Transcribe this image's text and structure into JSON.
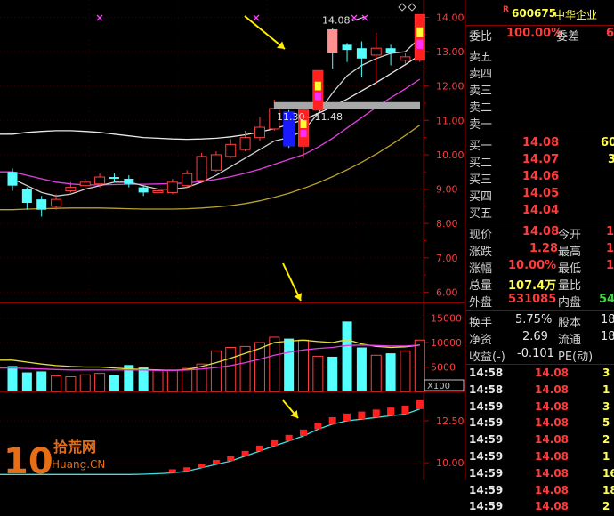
{
  "price_axis": [
    "14.00",
    "13.00",
    "12.00",
    "11.00",
    "10.00",
    "9.00",
    "8.00",
    "7.00",
    "6.00"
  ],
  "volume_axis": [
    "15000",
    "10000",
    "5000"
  ],
  "volume_unit": "X100",
  "indicator_axis": [
    "12.50",
    "10.00"
  ],
  "chart_annotations": {
    "high_label": "14.08",
    "range_label": "11.30 - 11.48"
  },
  "watermark": {
    "number": "10",
    "site": "拾荒网",
    "domain": "Huang.CN"
  },
  "quote": {
    "marker": "R",
    "code": "600675",
    "name": "中华企业",
    "webi_label": "委比",
    "webi_value": "100.00%",
    "weicha_label": "委差",
    "weicha_value": "6",
    "sell_labels": [
      "卖五",
      "卖四",
      "卖三",
      "卖二",
      "卖一"
    ],
    "buy": [
      {
        "label": "买一",
        "price": "14.08",
        "vol": "60"
      },
      {
        "label": "买二",
        "price": "14.07",
        "vol": "3"
      },
      {
        "label": "买三",
        "price": "14.06",
        "vol": ""
      },
      {
        "label": "买四",
        "price": "14.05",
        "vol": ""
      },
      {
        "label": "买五",
        "price": "14.04",
        "vol": ""
      }
    ],
    "stats": [
      {
        "l1": "现价",
        "v1": "14.08",
        "c1": "red",
        "l2": "今开",
        "v2": "1"
      },
      {
        "l1": "涨跌",
        "v1": "1.28",
        "c1": "red",
        "l2": "最高",
        "v2": "1"
      },
      {
        "l1": "涨幅",
        "v1": "10.00%",
        "c1": "red",
        "l2": "最低",
        "v2": "1"
      },
      {
        "l1": "总量",
        "v1": "107.4万",
        "c1": "yel",
        "l2": "量比",
        "v2": ""
      },
      {
        "l1": "外盘",
        "v1": "531085",
        "c1": "red",
        "l2": "内盘",
        "v2": "54"
      }
    ],
    "extra": [
      {
        "l1": "换手",
        "v1": "5.75%",
        "l2": "股本",
        "v2": "18"
      },
      {
        "l1": "净资",
        "v1": "2.69",
        "l2": "流通",
        "v2": "18"
      }
    ],
    "eps_label": "收益(-)",
    "eps_value": "-0.101",
    "pe_label": "PE(动)",
    "ticks": [
      {
        "time": "14:58",
        "price": "14.08",
        "vol": "3"
      },
      {
        "time": "14:58",
        "price": "14.08",
        "vol": "1"
      },
      {
        "time": "14:59",
        "price": "14.08",
        "vol": "3"
      },
      {
        "time": "14:59",
        "price": "14.08",
        "vol": "5"
      },
      {
        "time": "14:59",
        "price": "14.08",
        "vol": "2"
      },
      {
        "time": "14:59",
        "price": "14.08",
        "vol": "1"
      },
      {
        "time": "14:59",
        "price": "14.08",
        "vol": "16"
      },
      {
        "time": "14:59",
        "price": "14.08",
        "vol": "18"
      },
      {
        "time": "14:59",
        "price": "14.08",
        "vol": "2"
      }
    ]
  },
  "chart_data": {
    "type": "candlestick",
    "ylim": [
      5.7,
      14.4
    ],
    "volume_ylim": [
      0,
      18000
    ],
    "candles": [
      {
        "o": 9.5,
        "c": 9.1,
        "h": 9.6,
        "l": 8.95,
        "v": 5200
      },
      {
        "o": 9.0,
        "c": 8.6,
        "h": 9.05,
        "l": 8.4,
        "v": 3900
      },
      {
        "o": 8.7,
        "c": 8.4,
        "h": 8.8,
        "l": 8.2,
        "v": 4100
      },
      {
        "o": 8.5,
        "c": 8.7,
        "h": 8.85,
        "l": 8.4,
        "v": 3200
      },
      {
        "o": 8.95,
        "c": 9.05,
        "h": 9.2,
        "l": 8.9,
        "v": 3000
      },
      {
        "o": 9.1,
        "c": 9.2,
        "h": 9.3,
        "l": 9.05,
        "v": 3400
      },
      {
        "o": 9.15,
        "c": 9.35,
        "h": 9.45,
        "l": 9.05,
        "v": 3700
      },
      {
        "o": 9.35,
        "c": 9.3,
        "h": 9.45,
        "l": 9.2,
        "v": 3300
      },
      {
        "o": 9.3,
        "c": 9.15,
        "h": 9.4,
        "l": 9.05,
        "v": 5400
      },
      {
        "o": 9.05,
        "c": 8.9,
        "h": 9.1,
        "l": 8.8,
        "v": 4900
      },
      {
        "o": 8.9,
        "c": 8.95,
        "h": 9.05,
        "l": 8.8,
        "v": 4300
      },
      {
        "o": 8.9,
        "c": 9.2,
        "h": 9.3,
        "l": 8.85,
        "v": 4400
      },
      {
        "o": 9.1,
        "c": 9.45,
        "h": 9.55,
        "l": 9.05,
        "v": 4700
      },
      {
        "o": 9.25,
        "c": 9.95,
        "h": 10.05,
        "l": 9.2,
        "v": 5600
      },
      {
        "o": 9.55,
        "c": 10.0,
        "h": 10.1,
        "l": 9.5,
        "v": 8300
      },
      {
        "o": 9.95,
        "c": 10.3,
        "h": 10.45,
        "l": 9.9,
        "v": 9000
      },
      {
        "o": 10.15,
        "c": 10.5,
        "h": 10.7,
        "l": 10.1,
        "v": 9200
      },
      {
        "o": 10.5,
        "c": 10.8,
        "h": 11.1,
        "l": 10.4,
        "v": 10000
      },
      {
        "o": 10.75,
        "c": 11.35,
        "h": 11.6,
        "l": 10.7,
        "v": 11100
      },
      {
        "o": 11.25,
        "c": 10.25,
        "h": 11.3,
        "l": 10.2,
        "v": 10800
      },
      {
        "o": 10.25,
        "c": 11.3,
        "h": 11.4,
        "l": 9.9,
        "v": 10500
      },
      {
        "o": 11.3,
        "c": 12.45,
        "h": 12.45,
        "l": 11.3,
        "v": 7200
      },
      {
        "o": 13.65,
        "c": 12.95,
        "h": 13.7,
        "l": 12.5,
        "v": 7100
      },
      {
        "o": 13.2,
        "c": 13.05,
        "h": 13.25,
        "l": 12.7,
        "v": 14300
      },
      {
        "o": 13.1,
        "c": 12.8,
        "h": 13.3,
        "l": 12.25,
        "v": 9000
      },
      {
        "o": 12.9,
        "c": 13.1,
        "h": 13.55,
        "l": 12.1,
        "v": 7400
      },
      {
        "o": 13.1,
        "c": 12.95,
        "h": 13.2,
        "l": 12.6,
        "v": 7800
      },
      {
        "o": 12.75,
        "c": 12.85,
        "h": 12.95,
        "l": 12.65,
        "v": 8300
      },
      {
        "o": 12.75,
        "c": 14.08,
        "h": 14.08,
        "l": 12.7,
        "v": 10500
      }
    ],
    "ma_short": [
      9.3,
      9.1,
      8.9,
      8.8,
      8.85,
      9.0,
      9.1,
      9.2,
      9.2,
      9.1,
      9.0,
      9.0,
      9.05,
      9.2,
      9.4,
      9.65,
      9.9,
      10.15,
      10.4,
      10.5,
      10.7,
      11.2,
      11.8,
      12.3,
      12.6,
      12.8,
      12.95,
      13.0,
      13.4
    ],
    "ma_mid": [
      9.5,
      9.4,
      9.3,
      9.2,
      9.15,
      9.12,
      9.12,
      9.13,
      9.14,
      9.14,
      9.15,
      9.16,
      9.18,
      9.22,
      9.28,
      9.36,
      9.46,
      9.58,
      9.72,
      9.86,
      10.0,
      10.22,
      10.48,
      10.78,
      11.08,
      11.38,
      11.66,
      11.92,
      12.2
    ],
    "ma_long": [
      10.6,
      10.65,
      10.68,
      10.7,
      10.7,
      10.68,
      10.65,
      10.6,
      10.55,
      10.5,
      10.48,
      10.46,
      10.45,
      10.46,
      10.48,
      10.52,
      10.58,
      10.66,
      10.76,
      10.88,
      11.02,
      11.2,
      11.4,
      11.62,
      11.86,
      12.1,
      12.36,
      12.62,
      12.9
    ],
    "ma_xlong": [
      8.4,
      8.42,
      8.43,
      8.44,
      8.45,
      8.45,
      8.45,
      8.44,
      8.43,
      8.42,
      8.42,
      8.42,
      8.43,
      8.45,
      8.48,
      8.52,
      8.58,
      8.66,
      8.76,
      8.88,
      9.02,
      9.18,
      9.36,
      9.56,
      9.78,
      10.02,
      10.28,
      10.56,
      10.86
    ],
    "vol_ma_a": [
      6400,
      6000,
      5600,
      5300,
      5100,
      5000,
      5000,
      4800,
      4600,
      4500,
      4400,
      4300,
      4500,
      5100,
      5900,
      6800,
      7800,
      8800,
      10000,
      10300,
      10500,
      10200,
      10000,
      10600,
      9700,
      9200,
      9000,
      9100,
      9500
    ],
    "vol_ma_b": [
      4800,
      4700,
      4600,
      4500,
      4400,
      4400,
      4400,
      4400,
      4400,
      4400,
      4300,
      4300,
      4400,
      4600,
      4900,
      5300,
      5900,
      6600,
      7400,
      8000,
      8500,
      8800,
      9000,
      9400,
      9500,
      9400,
      9300,
      9300,
      9500
    ],
    "indicator_line": [
      9.3,
      9.3,
      9.3,
      9.3,
      9.3,
      9.3,
      9.3,
      9.3,
      9.3,
      9.32,
      9.35,
      9.4,
      9.5,
      9.7,
      9.9,
      10.1,
      10.4,
      10.7,
      11.0,
      11.3,
      11.6,
      12.0,
      12.3,
      12.5,
      12.6,
      12.7,
      12.8,
      12.9,
      13.2
    ],
    "indicator_ylim": [
      9.0,
      14.2
    ]
  }
}
